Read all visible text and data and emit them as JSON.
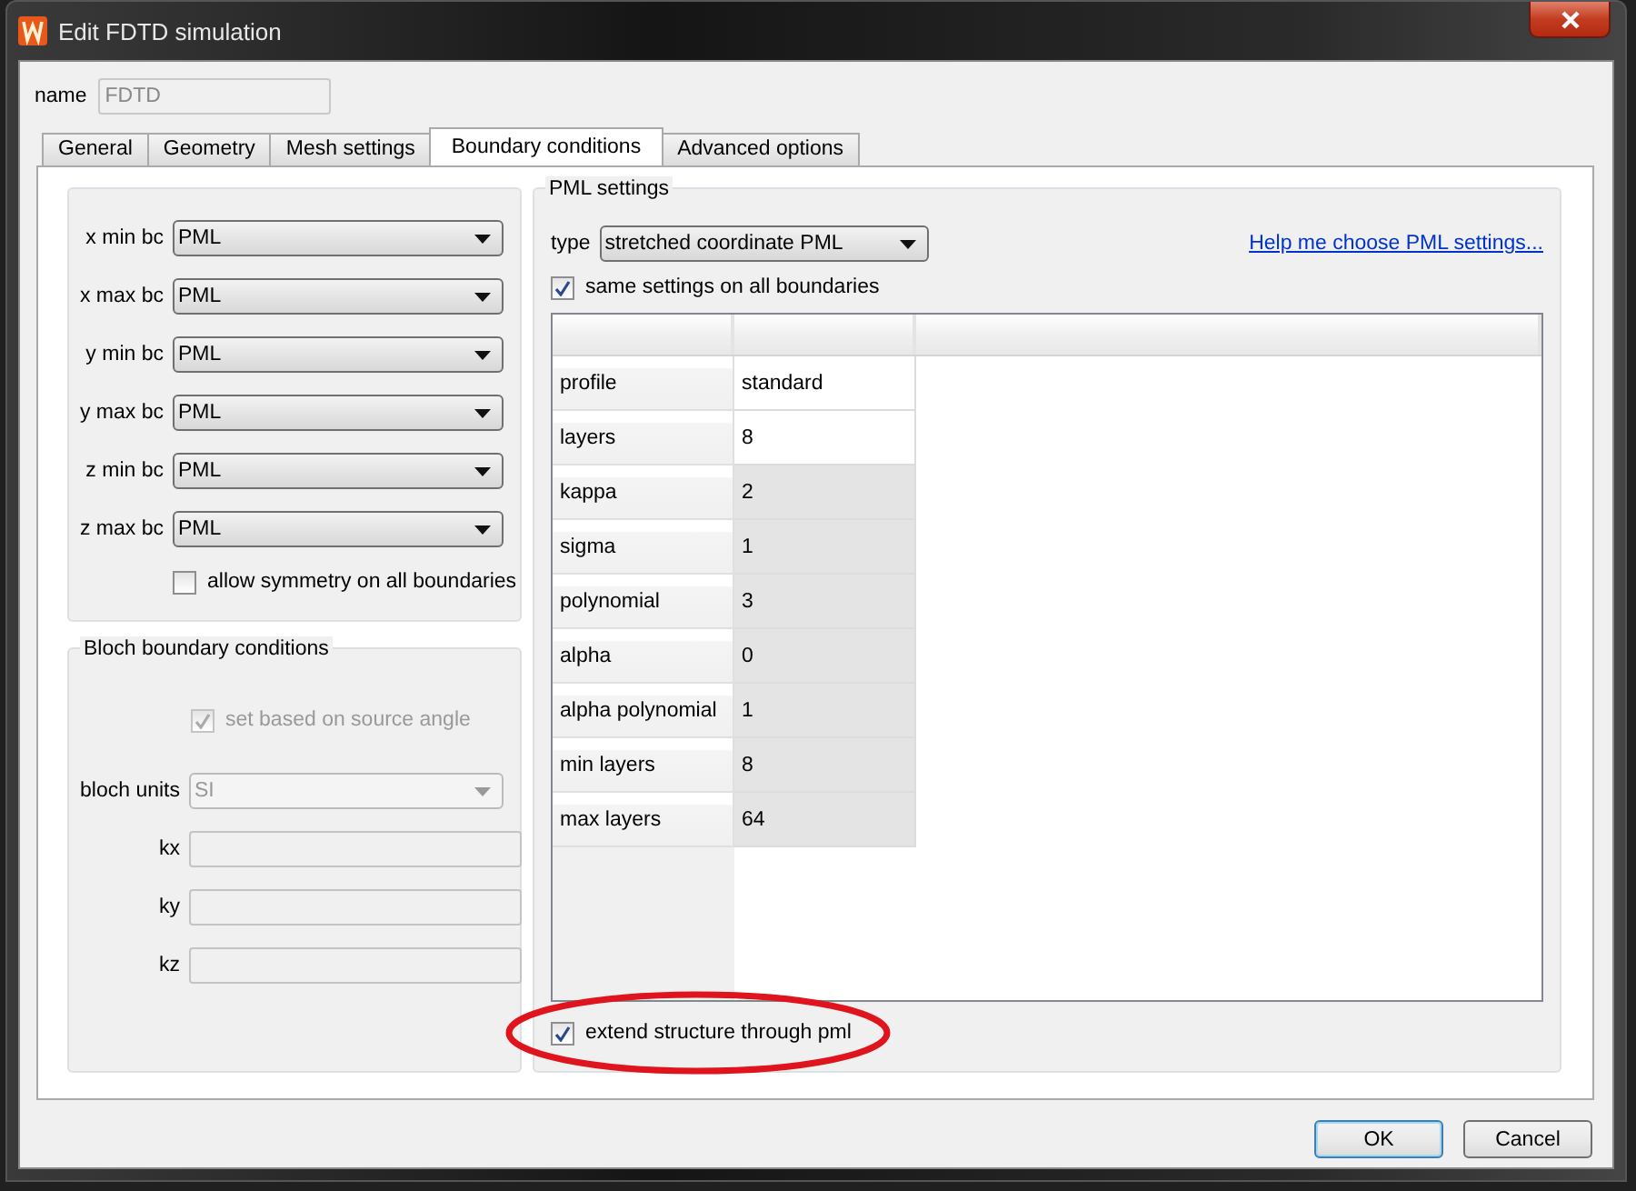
{
  "window": {
    "title": "Edit FDTD simulation"
  },
  "name_field": {
    "label": "name",
    "value": "FDTD",
    "disabled": true
  },
  "tabs": [
    {
      "label": "General",
      "selected": false
    },
    {
      "label": "Geometry",
      "selected": false
    },
    {
      "label": "Mesh settings",
      "selected": false
    },
    {
      "label": "Boundary conditions",
      "selected": true
    },
    {
      "label": "Advanced options",
      "selected": false
    }
  ],
  "boundaries": [
    {
      "label": "x min bc",
      "value": "PML"
    },
    {
      "label": "x max bc",
      "value": "PML"
    },
    {
      "label": "y min bc",
      "value": "PML"
    },
    {
      "label": "y max bc",
      "value": "PML"
    },
    {
      "label": "z min bc",
      "value": "PML"
    },
    {
      "label": "z max bc",
      "value": "PML"
    }
  ],
  "allow_symmetry": {
    "label": "allow symmetry on all boundaries",
    "checked": false
  },
  "bloch": {
    "title": "Bloch boundary conditions",
    "source_angle": {
      "label": "set based on source angle",
      "checked": true,
      "disabled": true
    },
    "units": {
      "label": "bloch units",
      "value": "SI",
      "disabled": true
    },
    "fields": [
      {
        "label": "kx",
        "disabled": true
      },
      {
        "label": "ky",
        "disabled": true
      },
      {
        "label": "kz",
        "disabled": true
      }
    ]
  },
  "pml": {
    "title": "PML settings",
    "type": {
      "label": "type",
      "value": "stretched coordinate PML"
    },
    "help_link": "Help me choose PML settings...",
    "same_settings": {
      "label": "same settings on all boundaries",
      "checked": true
    },
    "rows": [
      {
        "name": "profile",
        "value": "standard",
        "shaded": false
      },
      {
        "name": "layers",
        "value": "8",
        "shaded": false
      },
      {
        "name": "kappa",
        "value": "2",
        "shaded": true
      },
      {
        "name": "sigma",
        "value": "1",
        "shaded": true
      },
      {
        "name": "polynomial",
        "value": "3",
        "shaded": true
      },
      {
        "name": "alpha",
        "value": "0",
        "shaded": true
      },
      {
        "name": "alpha polynomial",
        "value": "1",
        "shaded": true
      },
      {
        "name": "min layers",
        "value": "8",
        "shaded": true
      },
      {
        "name": "max layers",
        "value": "64",
        "shaded": true
      }
    ]
  },
  "extend": {
    "label": "extend structure through pml",
    "checked": true,
    "highlighted": true
  },
  "buttons": [
    {
      "label": "OK",
      "default": true
    },
    {
      "label": "Cancel",
      "default": false
    }
  ]
}
